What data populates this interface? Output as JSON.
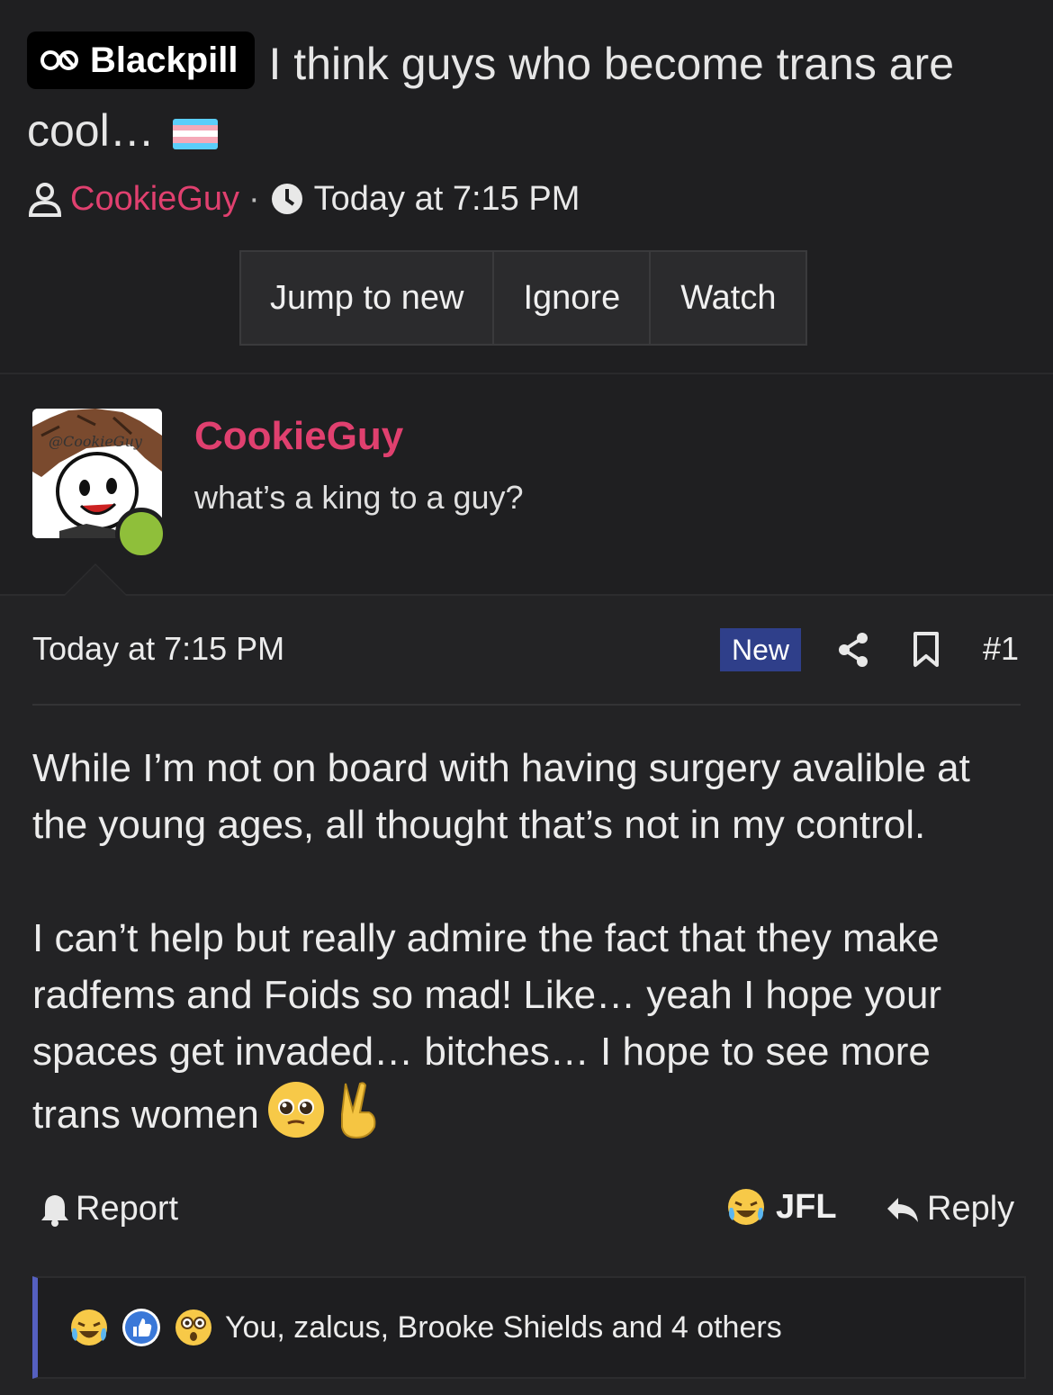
{
  "thread": {
    "prefix_label": "Blackpill",
    "title": "I think guys who become trans are cool…",
    "author": "CookieGuy",
    "meta_separator": "·",
    "timestamp": "Today at 7:15 PM",
    "buttons": [
      "Jump to new",
      "Ignore",
      "Watch"
    ],
    "flag_colors": [
      "#5BCEFA",
      "#F5A9B8",
      "#FFFFFF",
      "#F5A9B8",
      "#5BCEFA"
    ]
  },
  "user": {
    "name": "CookieGuy",
    "user_title": "what’s a king to a guy?",
    "avatar_signature": "@CookieGuy",
    "online_color": "#8fbf3a"
  },
  "post": {
    "timestamp": "Today at 7:15 PM",
    "new_badge": "New",
    "number": "#1",
    "paragraph_1": "While I’m not on board with having surgery avalible at the young ages, all thought that’s not in my control.",
    "paragraph_2": "I can’t help but really admire the fact that they make radfems and Foids so mad! Like… yeah I hope your spaces get invaded… bitches… I hope to see more trans women",
    "inline_emojis": [
      "pleading-face",
      "victory-hand"
    ]
  },
  "actions": {
    "report_label": "Report",
    "reaction_label": "JFL",
    "reply_label": "Reply"
  },
  "reactions": {
    "icons": [
      "crying-laughing",
      "thumbs-up",
      "astonished"
    ],
    "summary": "You, zalcus, Brooke Shields and 4 others"
  },
  "colors": {
    "accent_pink": "#e0406f",
    "new_badge_bg": "#2f3f8a",
    "reaction_bar_accent": "#5560c0"
  }
}
